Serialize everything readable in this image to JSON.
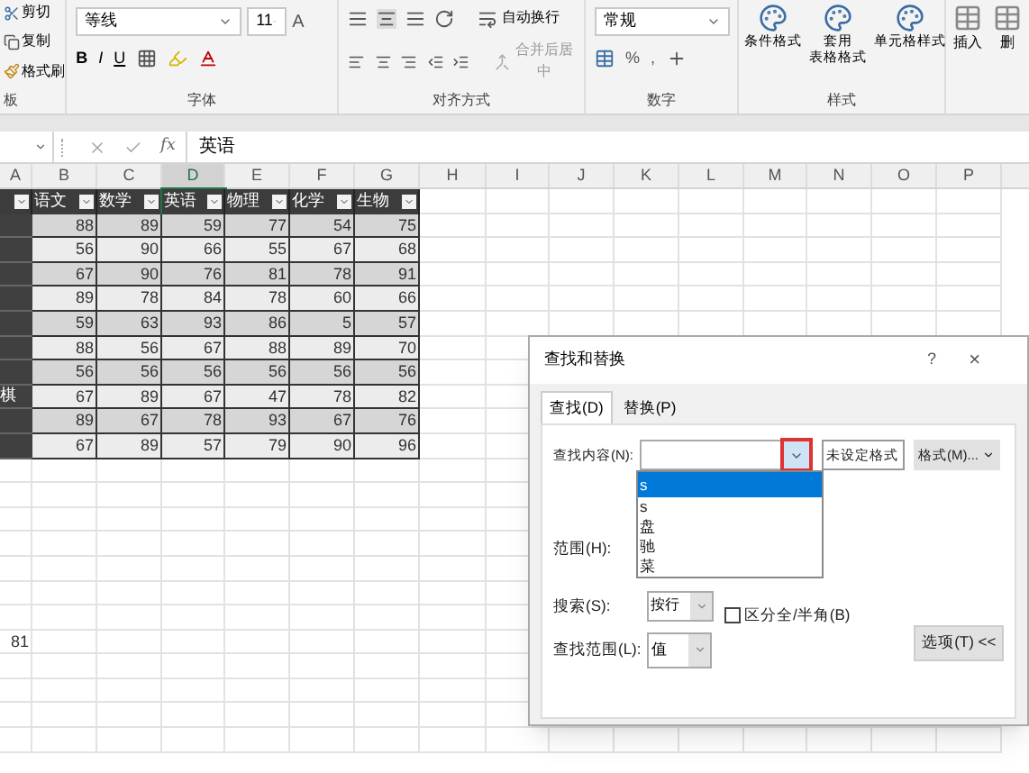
{
  "ribbon": {
    "clipboard": {
      "items": [
        "剪切",
        "复制",
        "格式刷"
      ],
      "group_label": "板"
    },
    "font": {
      "name": "等线",
      "size": "11",
      "bold": "B",
      "italic": "I",
      "underline": "U",
      "grow_font": "A",
      "group_label": "字体"
    },
    "alignment": {
      "wrap": "自动换行",
      "merge": "合并后居中",
      "group_label": "对齐方式"
    },
    "number": {
      "format": "常规",
      "percent": "%",
      "comma": ",",
      "group_label": "数字"
    },
    "styles": {
      "items": [
        {
          "lines": [
            "条件格式"
          ]
        },
        {
          "lines": [
            "套用",
            "表格格式"
          ]
        },
        {
          "lines": [
            "单元格样式"
          ]
        }
      ],
      "group_label": "样式"
    },
    "cells": {
      "items": [
        "插入",
        "删"
      ]
    }
  },
  "formula_bar": {
    "function_label": "fx",
    "content": "英语"
  },
  "sheet": {
    "columns": [
      {
        "label": "A",
        "selected": false
      },
      {
        "label": "B",
        "selected": false
      },
      {
        "label": "C",
        "selected": false
      },
      {
        "label": "D",
        "selected": true
      },
      {
        "label": "E",
        "selected": false
      },
      {
        "label": "F",
        "selected": false
      },
      {
        "label": "G",
        "selected": false
      },
      {
        "label": "H",
        "selected": false
      },
      {
        "label": "I",
        "selected": false
      },
      {
        "label": "J",
        "selected": false
      },
      {
        "label": "K",
        "selected": false
      },
      {
        "label": "L",
        "selected": false
      },
      {
        "label": "M",
        "selected": false
      },
      {
        "label": "N",
        "selected": false
      },
      {
        "label": "O",
        "selected": false
      },
      {
        "label": "P",
        "selected": false
      }
    ],
    "headers": [
      "语文",
      "数学",
      "英语",
      "物理",
      "化学",
      "生物"
    ],
    "rows": [
      {
        "a": "",
        "values": [
          "88",
          "89",
          "59",
          "77",
          "54",
          "75"
        ]
      },
      {
        "a": "",
        "values": [
          "56",
          "90",
          "66",
          "55",
          "67",
          "68"
        ]
      },
      {
        "a": "",
        "values": [
          "67",
          "90",
          "76",
          "81",
          "78",
          "91"
        ]
      },
      {
        "a": "",
        "values": [
          "89",
          "78",
          "84",
          "78",
          "60",
          "66"
        ]
      },
      {
        "a": "",
        "values": [
          "59",
          "63",
          "93",
          "86",
          "5",
          "57"
        ]
      },
      {
        "a": "",
        "values": [
          "88",
          "56",
          "67",
          "88",
          "89",
          "70"
        ]
      },
      {
        "a": "",
        "values": [
          "56",
          "56",
          "56",
          "56",
          "56",
          "56"
        ]
      },
      {
        "a": "棋",
        "values": [
          "67",
          "89",
          "67",
          "47",
          "78",
          "82"
        ]
      },
      {
        "a": "",
        "values": [
          "89",
          "67",
          "78",
          "93",
          "67",
          "76"
        ]
      },
      {
        "a": "",
        "values": [
          "67",
          "89",
          "57",
          "79",
          "90",
          "96"
        ]
      }
    ],
    "loose_cell": "81"
  },
  "dialog": {
    "title": "查找和替换",
    "help": "?",
    "close": "×",
    "tabs": [
      {
        "label": "查找(D)",
        "selected": true
      },
      {
        "label": "替换(P)",
        "selected": false
      }
    ],
    "find_label": "查找内容(N):",
    "format_preview": "未设定格式",
    "format_button": "格式(M)...",
    "history": [
      {
        "label": "s",
        "selected": true
      },
      {
        "label": "s",
        "selected": false
      },
      {
        "label": "盘",
        "selected": false
      },
      {
        "label": "驰",
        "selected": false
      },
      {
        "label": "菜",
        "selected": false
      }
    ],
    "within_label": "范围(H):",
    "search_label": "搜索(S):",
    "search_value": "按行",
    "width_option": {
      "label": "区分全/半角(B)",
      "checked": false
    },
    "look_in_label": "查找范围(L):",
    "look_in_value": "值",
    "options_button": "选项(T) <<"
  }
}
